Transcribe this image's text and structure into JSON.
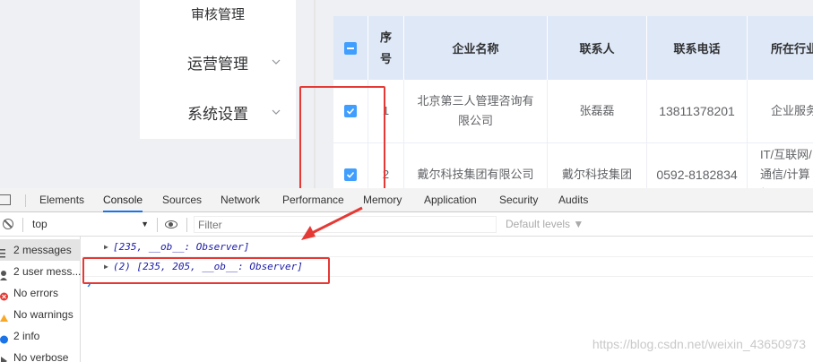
{
  "sidebar": {
    "items": [
      {
        "label": "审核管理"
      },
      {
        "label": "运营管理"
      },
      {
        "label": "系统设置"
      }
    ]
  },
  "table": {
    "headers": [
      "序号",
      "企业名称",
      "联系人",
      "联系电话",
      "所在行业"
    ],
    "rows": [
      {
        "index": "1",
        "company": "北京第三人管理咨询有限公司",
        "contact": "张磊磊",
        "phone": "13811378201",
        "industry": "企业服务"
      },
      {
        "index": "2",
        "company": "戴尔科技集团有限公司",
        "contact": "戴尔科技集团",
        "phone": "0592-8182834",
        "industry": "IT/互联网/通信/计算机"
      }
    ]
  },
  "devtools": {
    "tabs": [
      "Elements",
      "Console",
      "Sources",
      "Network",
      "Performance",
      "Memory",
      "Application",
      "Security",
      "Audits"
    ],
    "active_tab": "Console",
    "context": "top",
    "filter_placeholder": "Filter",
    "levels": "Default levels ▼",
    "sidebar": [
      {
        "label": "2 messages",
        "icon": "list-icon"
      },
      {
        "label": "2 user mess...",
        "icon": "user-icon"
      },
      {
        "label": "No errors",
        "icon": "error-icon"
      },
      {
        "label": "No warnings",
        "icon": "warning-icon"
      },
      {
        "label": "2 info",
        "icon": "info-icon"
      },
      {
        "label": "No verbose",
        "icon": "verbose-icon"
      }
    ],
    "logs": [
      {
        "text": "[235, __ob__: Observer]"
      },
      {
        "text": "(2) [235, 205, __ob__: Observer]"
      }
    ],
    "prompt": "›"
  },
  "watermark": "https://blog.csdn.net/weixin_43650973",
  "colors": {
    "accent": "#409eff",
    "header_bg": "#dfe8f7",
    "annotation": "#e53935"
  }
}
